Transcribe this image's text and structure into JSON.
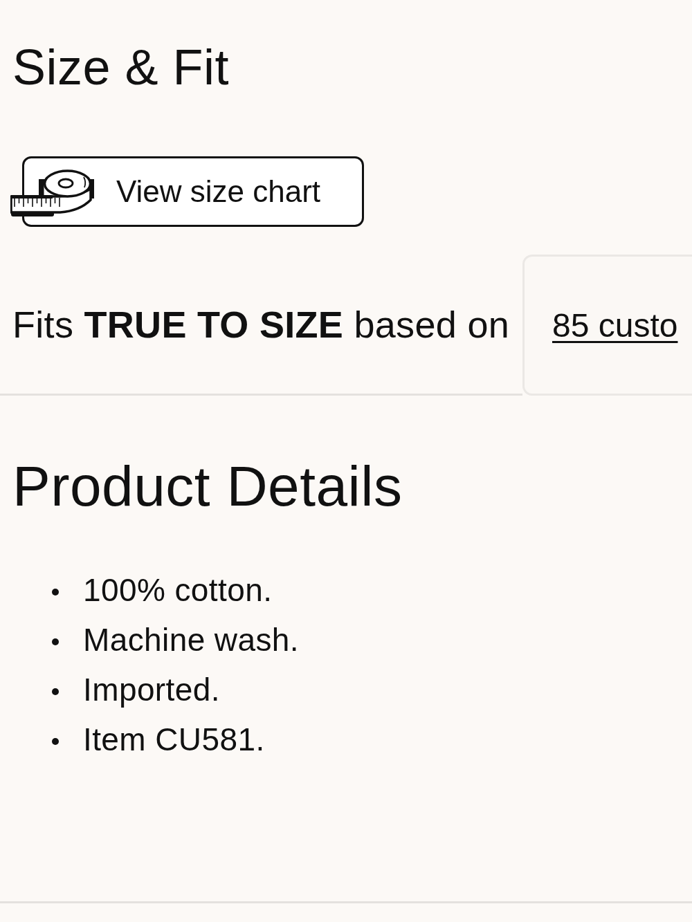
{
  "size_fit": {
    "title": "Size & Fit",
    "size_chart_button": {
      "label": "View size chart"
    },
    "fit_summary": "Fits **TRUE TO SIZE** based on",
    "reviews_link": "85 custo"
  },
  "product_details": {
    "title": "Product Details",
    "items": [
      "100% cotton.",
      "Machine wash.",
      "Imported.",
      "Item CU581."
    ]
  }
}
